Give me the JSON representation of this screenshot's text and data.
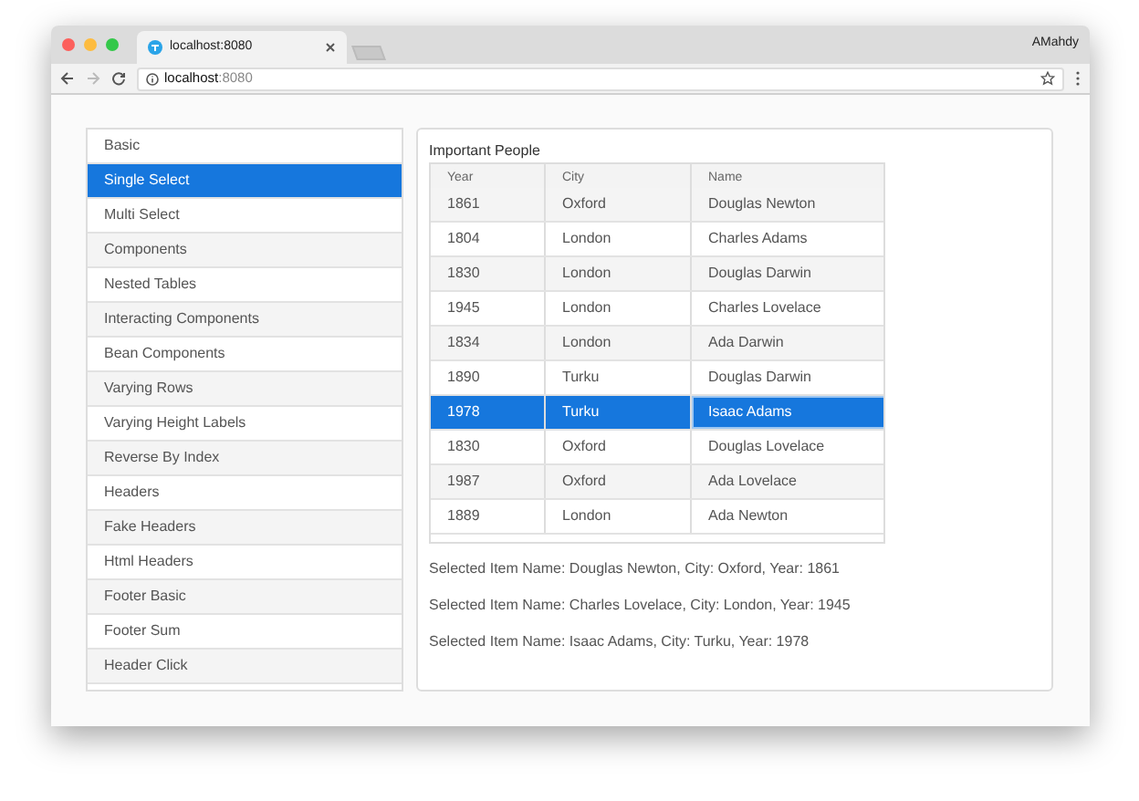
{
  "browser": {
    "tab_title": "localhost:8080",
    "profile": "AMahdy",
    "address": "localhost",
    "address_port": ":8080"
  },
  "sidebar": {
    "items": [
      {
        "label": "Basic",
        "selected": false
      },
      {
        "label": "Single Select",
        "selected": true
      },
      {
        "label": "Multi Select",
        "selected": false
      },
      {
        "label": "Components",
        "selected": false
      },
      {
        "label": "Nested Tables",
        "selected": false
      },
      {
        "label": "Interacting Components",
        "selected": false
      },
      {
        "label": "Bean Components",
        "selected": false
      },
      {
        "label": "Varying Rows",
        "selected": false
      },
      {
        "label": "Varying Height Labels",
        "selected": false
      },
      {
        "label": "Reverse By Index",
        "selected": false
      },
      {
        "label": "Headers",
        "selected": false
      },
      {
        "label": "Fake Headers",
        "selected": false
      },
      {
        "label": "Html Headers",
        "selected": false
      },
      {
        "label": "Footer Basic",
        "selected": false
      },
      {
        "label": "Footer Sum",
        "selected": false
      },
      {
        "label": "Header Click",
        "selected": false
      }
    ]
  },
  "panel": {
    "title": "Important People",
    "table": {
      "columns": [
        "Year",
        "City",
        "Name"
      ],
      "rows": [
        {
          "cells": [
            "1861",
            "Oxford",
            "Douglas Newton"
          ],
          "selected": false
        },
        {
          "cells": [
            "1804",
            "London",
            "Charles Adams"
          ],
          "selected": false
        },
        {
          "cells": [
            "1830",
            "London",
            "Douglas Darwin"
          ],
          "selected": false
        },
        {
          "cells": [
            "1945",
            "London",
            "Charles Lovelace"
          ],
          "selected": false
        },
        {
          "cells": [
            "1834",
            "London",
            "Ada Darwin"
          ],
          "selected": false
        },
        {
          "cells": [
            "1890",
            "Turku",
            "Douglas Darwin"
          ],
          "selected": false
        },
        {
          "cells": [
            "1978",
            "Turku",
            "Isaac Adams"
          ],
          "selected": true
        },
        {
          "cells": [
            "1830",
            "Oxford",
            "Douglas Lovelace"
          ],
          "selected": false
        },
        {
          "cells": [
            "1987",
            "Oxford",
            "Ada Lovelace"
          ],
          "selected": false
        },
        {
          "cells": [
            "1889",
            "London",
            "Ada Newton"
          ],
          "selected": false
        }
      ]
    },
    "messages": [
      "Selected Item Name: Douglas Newton, City: Oxford, Year: 1861",
      "Selected Item Name: Charles Lovelace, City: London, Year: 1945",
      "Selected Item Name: Isaac Adams, City: Turku, Year: 1978"
    ]
  }
}
